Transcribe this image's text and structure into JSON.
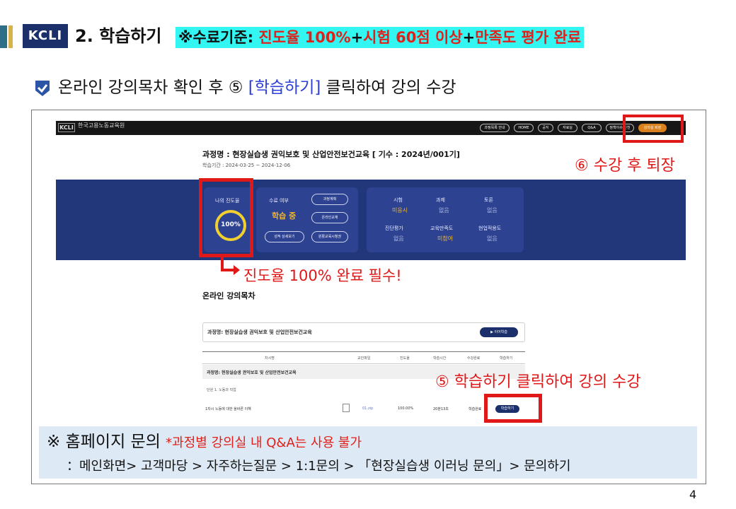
{
  "header": {
    "logo": "KCLI",
    "title": "2. 학습하기",
    "criteria_label": "※수료기준:",
    "criteria_text1": "진도율 100%",
    "plus1": "+",
    "criteria_text2": "시험 60점 이상",
    "plus2": "+",
    "criteria_text3": "만족도 평가 완료"
  },
  "intro": {
    "text_before": "온라인 강의목차 확인 후 ⑤ ",
    "highlight": "[학습하기]",
    "text_after": " 클릭하여 강의 수강"
  },
  "site": {
    "logo": "KCLI",
    "name": "한국고용노동교육원",
    "nav": [
      "과정목록 안내",
      "HOME",
      "공지",
      "자료실",
      "Q&A",
      "정책이슈 인천",
      "강의실 퇴장"
    ]
  },
  "course": {
    "title": "과정명 : 현장실습생 권익보호 및 산업안전보건교육 [ 기수 : 2024년/001기]",
    "period": "학습기간 : 2024-03-25 ~ 2024-12-06"
  },
  "dashboard": {
    "progress_label": "나의 진도율",
    "progress_value": "100%",
    "progress_fraction": 1.0,
    "status_label": "수료 여부",
    "status_value": "학습 중",
    "buttons": [
      "과정계획",
      "온라인교재",
      "성적 상세보기",
      "원활교육시청권"
    ],
    "eval": [
      {
        "label": "시험",
        "value": "미응시",
        "highlight": true
      },
      {
        "label": "과제",
        "value": "없음",
        "highlight": false
      },
      {
        "label": "토론",
        "value": "없음",
        "highlight": false
      },
      {
        "label": "진단평가",
        "value": "없음",
        "highlight": false
      },
      {
        "label": "교육만족도",
        "value": "미참여",
        "highlight": true
      },
      {
        "label": "현업적용도",
        "value": "없음",
        "highlight": false
      }
    ]
  },
  "callouts": {
    "exit": "⑥ 수강 후 퇴장",
    "progress": "진도율 100% 완료 필수!",
    "learn": "⑤ 학습하기 클릭하여 강의 수강"
  },
  "toc": {
    "title": "온라인 강의목차",
    "course_name": "과정명: 현장실습생 권익보호 및 산업안전보건교육",
    "continue_label": "▶ 이어학습",
    "columns": [
      "차시명",
      "교안파일",
      "진도율",
      "학습시간",
      "수강완료",
      "학습하기"
    ],
    "group_label": "과정명: 현장실습생 권익보호 및 산업안전보건교육",
    "section_label": "단원 1. 노동과 직업",
    "row": {
      "name": "1차시 노동에 대한 올바른 이해",
      "file": "01.zip",
      "progress": "100.00%",
      "time": "20분13초",
      "complete": "학습완료",
      "action": "학습하기"
    }
  },
  "notice": {
    "mark": "※ 홈페이지 문의",
    "note": "*과정별 강의실 내 Q&A는 사용 불가",
    "path": "：메인화면> 고객마당 > 자주하는질문 > 1:1문의 > 「현장실습생 이러닝 문의」> 문의하기"
  },
  "page_number": "4",
  "colors": {
    "navy": "#22367a",
    "accent_red": "#e01818",
    "highlight_cyan": "#33f5f2",
    "gold": "#f0b52d",
    "notice_bg": "#dde9f5"
  }
}
